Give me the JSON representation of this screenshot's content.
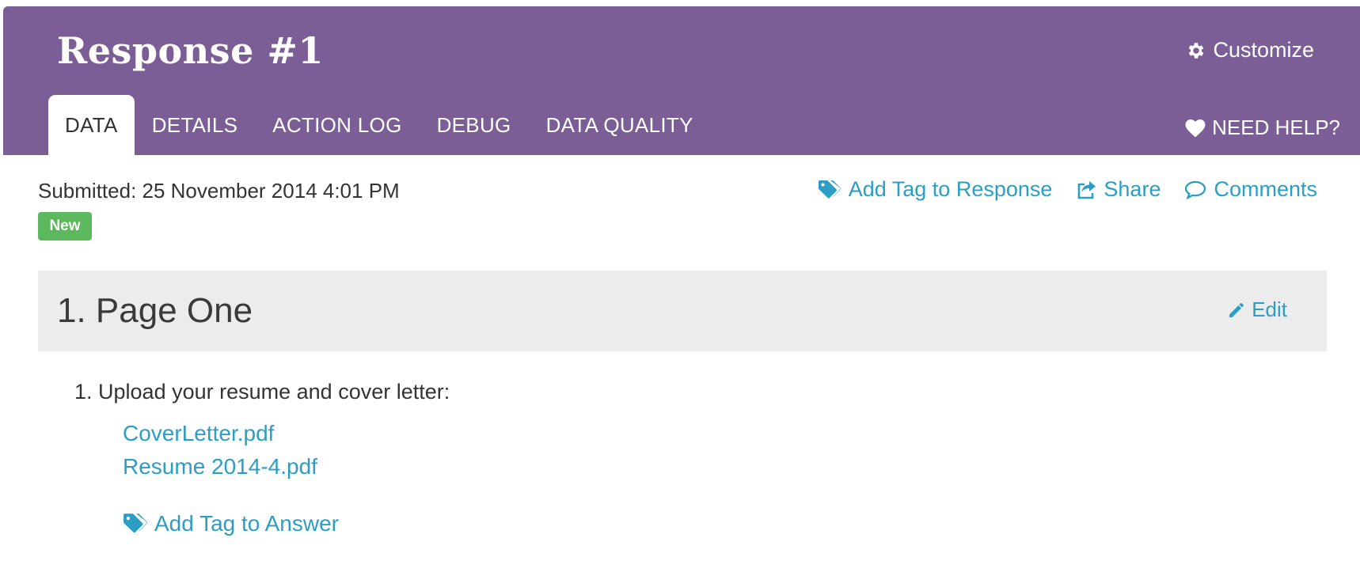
{
  "header": {
    "title": "Response #1",
    "customize_label": "Customize",
    "help_label": "NEED HELP?",
    "tabs": [
      {
        "label": "DATA",
        "active": true
      },
      {
        "label": "DETAILS",
        "active": false
      },
      {
        "label": "ACTION LOG",
        "active": false
      },
      {
        "label": "DEBUG",
        "active": false
      },
      {
        "label": "DATA QUALITY",
        "active": false
      }
    ]
  },
  "submission": {
    "submitted_text": "Submitted: 25 November 2014 4:01 PM",
    "status_badge": "New"
  },
  "actions": {
    "add_tag_label": "Add Tag to Response",
    "share_label": "Share",
    "comments_label": "Comments"
  },
  "section": {
    "title": "1. Page One",
    "edit_label": "Edit",
    "question": "1. Upload your resume and cover letter:",
    "files": [
      "CoverLetter.pdf",
      "Resume 2014-4.pdf"
    ],
    "add_tag_answer_label": "Add Tag to Answer"
  },
  "icons": {
    "customize": "gear-icon",
    "help": "heart-icon",
    "add_tag": "tags-icon",
    "share": "share-icon",
    "comments": "comment-icon",
    "edit": "pencil-icon"
  },
  "colors": {
    "header_bg": "#7b5e96",
    "link": "#2c9ec3",
    "badge_bg": "#5cb85c",
    "section_bg": "#ececec"
  }
}
